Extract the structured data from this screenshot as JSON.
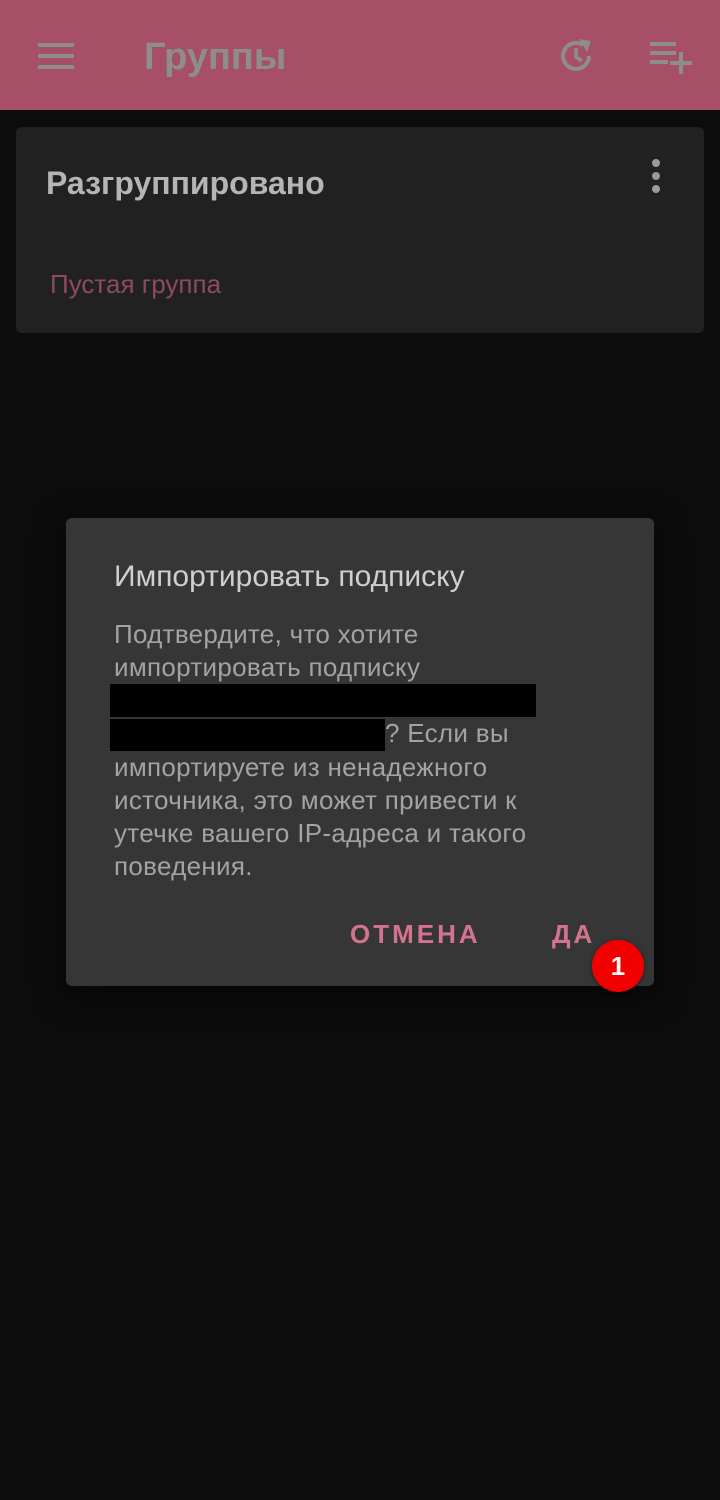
{
  "toolbar": {
    "title": "Группы",
    "menu_icon": "menu-icon",
    "history_icon": "history-refresh-icon",
    "add_icon": "playlist-add-icon",
    "bg_color": "#a84f68"
  },
  "group_card": {
    "title": "Разгруппировано",
    "subtitle": "Пустая группа",
    "more_icon": "more-vert-icon"
  },
  "dialog": {
    "title": "Импортировать подписку",
    "body_line1": "Подтвердите, что хотите",
    "body_line2": "импортировать подписку",
    "body_rest": "? Если вы импортируете из ненадежного источника, это может привести к утечке вашего IP-адреса и такого поведения.",
    "cancel_label": "ОТМЕНА",
    "ok_label": "ДА",
    "accent_color": "#d4738f"
  },
  "step_badge": {
    "label": "1",
    "color": "#f20000"
  }
}
